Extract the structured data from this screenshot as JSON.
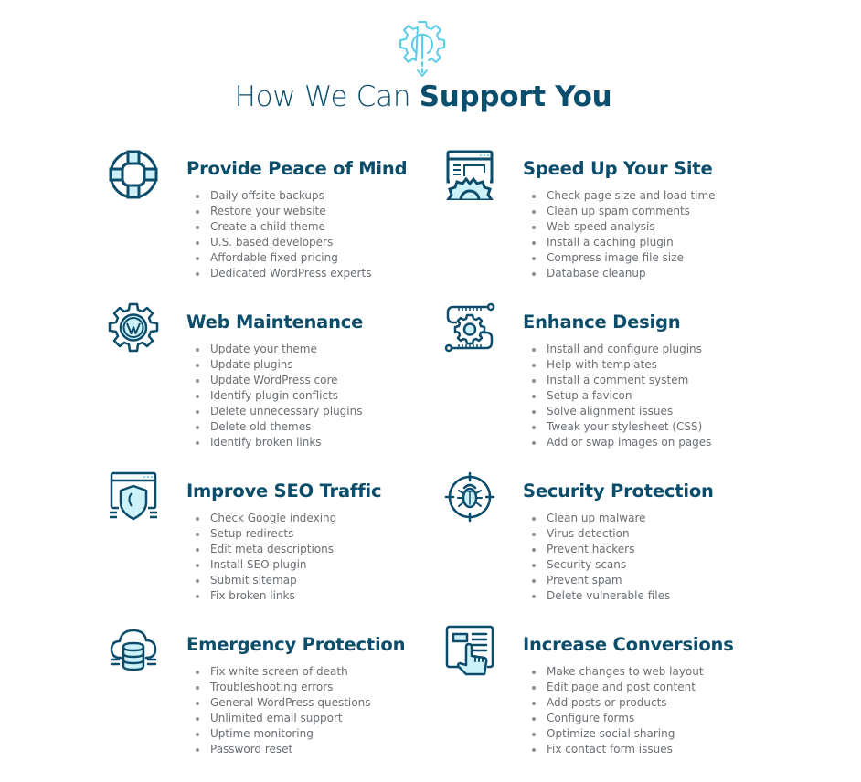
{
  "header": {
    "icon": "gear-download-icon",
    "title_light": "How We Can ",
    "title_bold": "Support You"
  },
  "colors": {
    "primary": "#0b4d6b",
    "accent": "#5bcde8",
    "light_fill": "#cdf1f9",
    "text": "#6a6f74"
  },
  "services": [
    {
      "icon": "life-ring-icon",
      "title": "Provide Peace of Mind",
      "items": [
        "Daily offsite backups",
        "Restore your website",
        "Create a child theme",
        "U.S. based developers",
        "Affordable fixed pricing",
        "Dedicated WordPress experts"
      ]
    },
    {
      "icon": "browser-gear-icon",
      "title": "Speed Up Your Site",
      "items": [
        "Check page size and load time",
        "Clean up spam comments",
        "Web speed analysis",
        "Install a caching plugin",
        "Compress image file size",
        "Database cleanup"
      ]
    },
    {
      "icon": "wordpress-gear-icon",
      "title": "Web Maintenance",
      "items": [
        "Update your theme",
        "Update plugins",
        "Update WordPress core",
        "Identify plugin conflicts",
        "Delete unnecessary plugins",
        "Delete old themes",
        "Identify broken links"
      ]
    },
    {
      "icon": "design-gear-circuit-icon",
      "title": "Enhance Design",
      "items": [
        "Install and configure plugins",
        "Help with templates",
        "Install a comment system",
        "Setup a favicon",
        "Solve alignment issues",
        "Tweak your stylesheet (CSS)",
        "Add or swap images on pages"
      ]
    },
    {
      "icon": "browser-shield-icon",
      "title": "Improve SEO Traffic",
      "items": [
        "Check Google indexing",
        "Setup redirects",
        "Edit meta descriptions",
        "Install SEO plugin",
        "Submit sitemap",
        "Fix broken links"
      ]
    },
    {
      "icon": "bug-target-icon",
      "title": "Security Protection",
      "items": [
        "Clean up malware",
        "Virus detection",
        "Prevent hackers",
        "Security scans",
        "Prevent spam",
        "Delete vulnerable files"
      ]
    },
    {
      "icon": "cloud-database-icon",
      "title": "Emergency Protection",
      "items": [
        "Fix white screen of death",
        "Troubleshooting errors",
        "General WordPress questions",
        "Unlimited email support",
        "Uptime monitoring",
        "Password reset"
      ]
    },
    {
      "icon": "click-layout-icon",
      "title": "Increase Conversions",
      "items": [
        "Make changes to web layout",
        "Edit page and post content",
        "Add posts or products",
        "Configure forms",
        "Optimize social sharing",
        "Fix contact form issues"
      ]
    }
  ]
}
